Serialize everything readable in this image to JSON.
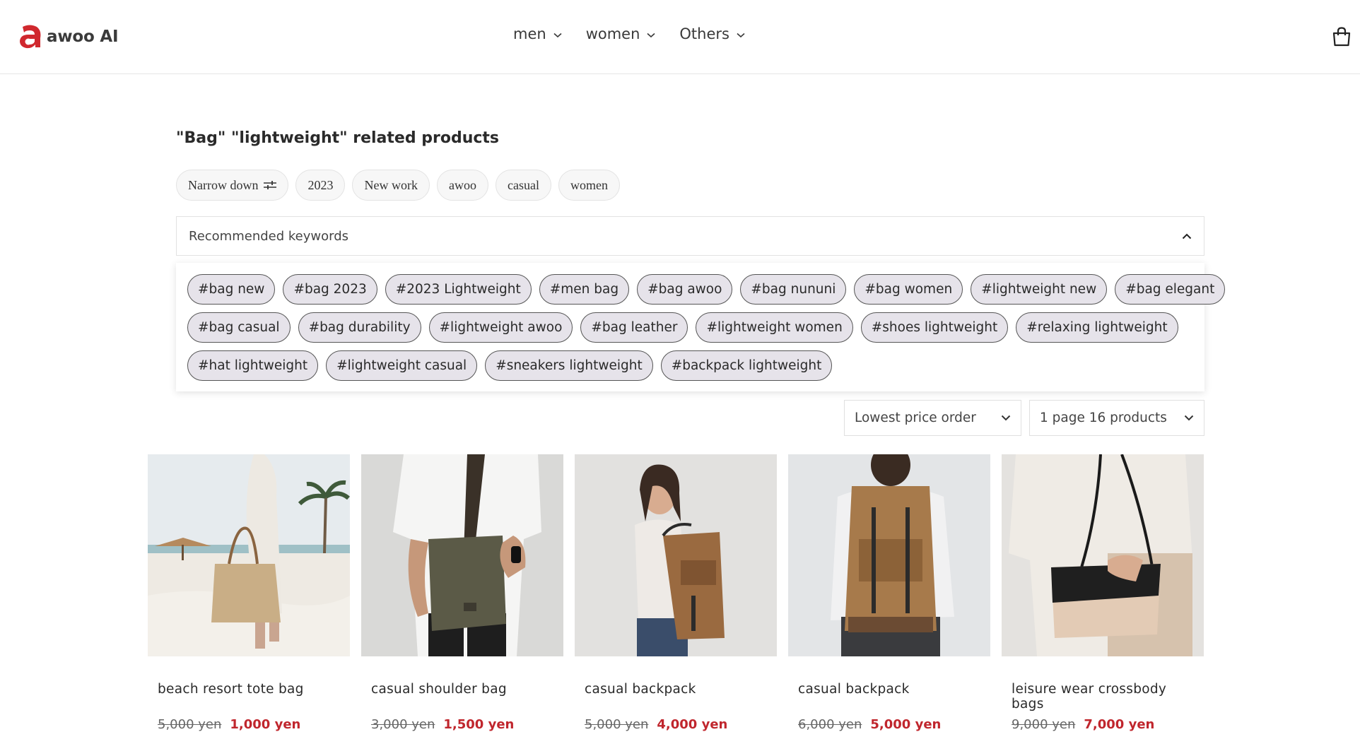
{
  "brand": {
    "name": "awoo AI",
    "accent": "#d0282e"
  },
  "nav": [
    {
      "label": "men"
    },
    {
      "label": "women"
    },
    {
      "label": "Others"
    }
  ],
  "page": {
    "title": "\"Bag\" \"lightweight\" related products"
  },
  "filters": [
    "Narrow down",
    "2023",
    "New work",
    "awoo",
    "casual",
    "women"
  ],
  "keywords": {
    "title": "Recommended keywords",
    "rows": [
      [
        "#bag new",
        "#bag 2023",
        "#2023 Lightweight",
        "#men bag",
        "#bag awoo",
        "#bag nununi",
        "#bag women",
        "#lightweight new",
        "#bag elegant"
      ],
      [
        "#bag casual",
        "#bag durability",
        "#lightweight awoo",
        "#bag leather",
        "#lightweight women",
        "#shoes lightweight",
        "#relaxing lightweight"
      ],
      [
        "#hat lightweight",
        "#lightweight casual",
        "#sneakers lightweight",
        "#backpack lightweight"
      ]
    ]
  },
  "sort": {
    "selected": "Lowest price order"
  },
  "per_page": {
    "selected": "1 page 16 products"
  },
  "products": [
    {
      "name": "beach resort tote bag",
      "old_price": "5,000 yen",
      "price": "1,000 yen",
      "image": "beach-tote-photo"
    },
    {
      "name": "casual shoulder bag",
      "old_price": "3,000 yen",
      "price": "1,500 yen",
      "image": "shoulder-bag-photo"
    },
    {
      "name": "casual backpack",
      "old_price": "5,000 yen",
      "price": "4,000 yen",
      "image": "woman-backpack-photo"
    },
    {
      "name": "casual backpack",
      "old_price": "6,000 yen",
      "price": "5,000 yen",
      "image": "man-backpack-photo"
    },
    {
      "name": "leisure wear crossbody bags",
      "old_price": "9,000 yen",
      "price": "7,000 yen",
      "image": "crossbody-bag-photo"
    }
  ]
}
